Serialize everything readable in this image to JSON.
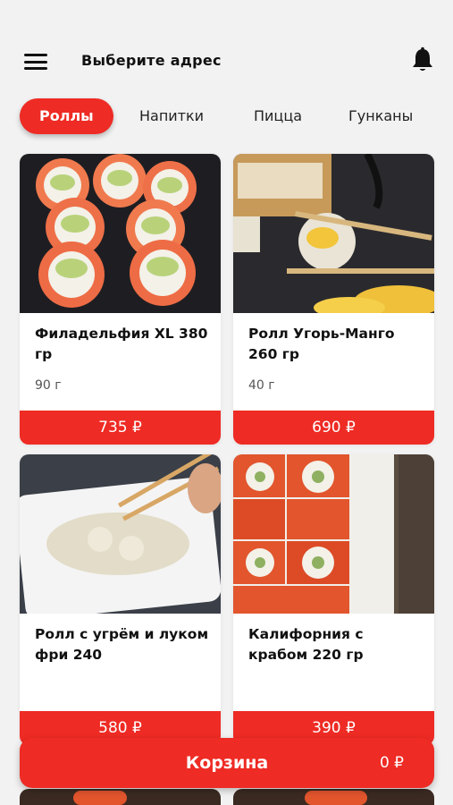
{
  "header": {
    "address_label": "Выберите адрес",
    "menu_icon": "hamburger-menu-icon",
    "bell_icon": "bell-icon"
  },
  "tabs": [
    {
      "label": "Роллы",
      "active": true
    },
    {
      "label": "Напитки",
      "active": false
    },
    {
      "label": "Пицца",
      "active": false
    },
    {
      "label": "Гунканы",
      "active": false
    }
  ],
  "products": [
    {
      "title": "Филадельфия XL 380 гр",
      "weight": "90 г",
      "price": "735 ₽"
    },
    {
      "title": "Ролл Угорь-Манго 260 гр",
      "weight": "40 г",
      "price": "690 ₽"
    },
    {
      "title": "Ролл с угрём и луком фри 240",
      "weight": "",
      "price": "580 ₽"
    },
    {
      "title": "Калифорния с крабом 220 гр",
      "weight": "",
      "price": "390 ₽"
    }
  ],
  "cart": {
    "label": "Корзина",
    "total": "0 ₽"
  },
  "colors": {
    "accent": "#ee2b24",
    "background": "#f2f2f2"
  }
}
